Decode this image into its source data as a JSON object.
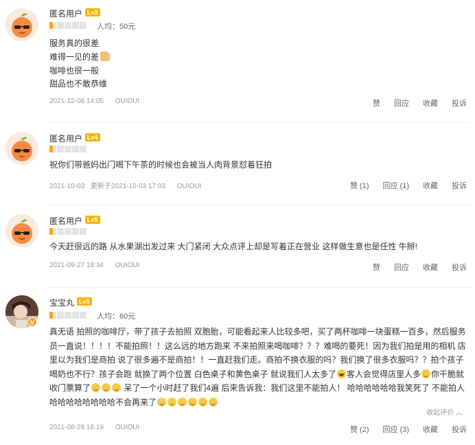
{
  "reviews": [
    {
      "username": "匿名用户",
      "level": "Lv3",
      "avg_label": "人均：50元",
      "rating": 0.5,
      "lines": [
        "服务真的很差",
        "难得一见的差",
        "咖啡也很一般",
        "甜品也不敢恭维"
      ],
      "date": "2021-12-06 14:05",
      "shop": "OUIOUI",
      "actions": [
        "赞",
        "回应",
        "收藏",
        "投诉"
      ]
    },
    {
      "username": "匿名用户",
      "level": "Lv4",
      "rating": 0.5,
      "text": "祝你们带爸妈出门喝下午茶的时候也会被当人肉背景怼着狂拍",
      "date": "2021-10-03",
      "updated": "更新于2021-10-03 17:03",
      "shop": "OUIOUI",
      "actions": [
        "赞 (1)",
        "回应 (1)",
        "收藏",
        "投诉"
      ]
    },
    {
      "username": "匿名用户",
      "level": "Lv5",
      "rating": 0.5,
      "text": "今天赶很远的路 从水果湖出发过来 大门紧闭 大众点评上却是写着正在营业 这样做生意也是任性 牛掰!",
      "date": "2021-09-27 18:34",
      "shop": "OUIOUI",
      "actions": [
        "赞",
        "回应",
        "收藏",
        "投诉"
      ]
    },
    {
      "username": "宝宝丸",
      "level": "Lv5",
      "avg_label": "人均：60元",
      "rating": 0.5,
      "text_part1": "真无语 拍照的咖啡厅，带了孩子去拍照 双胞胎，可能看起来人比较多吧，买了两杯咖啡一块蛋糕一百多，然后服务员一直说！！！！不能拍照！！这么远的地方跑来 不来拍照来喝咖啡？？？难喝的要死！因为我们拍是用的相机 店里以为我们是商拍 说了很多遍不是商拍！！一直赶我们走。商拍不换衣服的吗？我们换了很多衣服吗？？拍个孩子喝奶也不行？孩子会跑 就换了两个位置 白色桌子和黄色桌子 就说我们人太多了",
      "text_part2": "客人会觉得店里人多",
      "text_part3": "你干脆就收门票算了",
      "text_part4": "呆了一个小时赶了我们4遍 后来告诉我：我们这里不能拍人！ 哈哈哈哈哈哈我笑死了 不能拍人哈哈哈哈哈哈哈哈不会再来了",
      "collapse_label": "收起评价 ︿",
      "date": "2021-08-28 18:19",
      "shop": "OUIOUI",
      "actions": [
        "赞 (2)",
        "回应 (3)",
        "收藏",
        "投诉"
      ]
    }
  ]
}
